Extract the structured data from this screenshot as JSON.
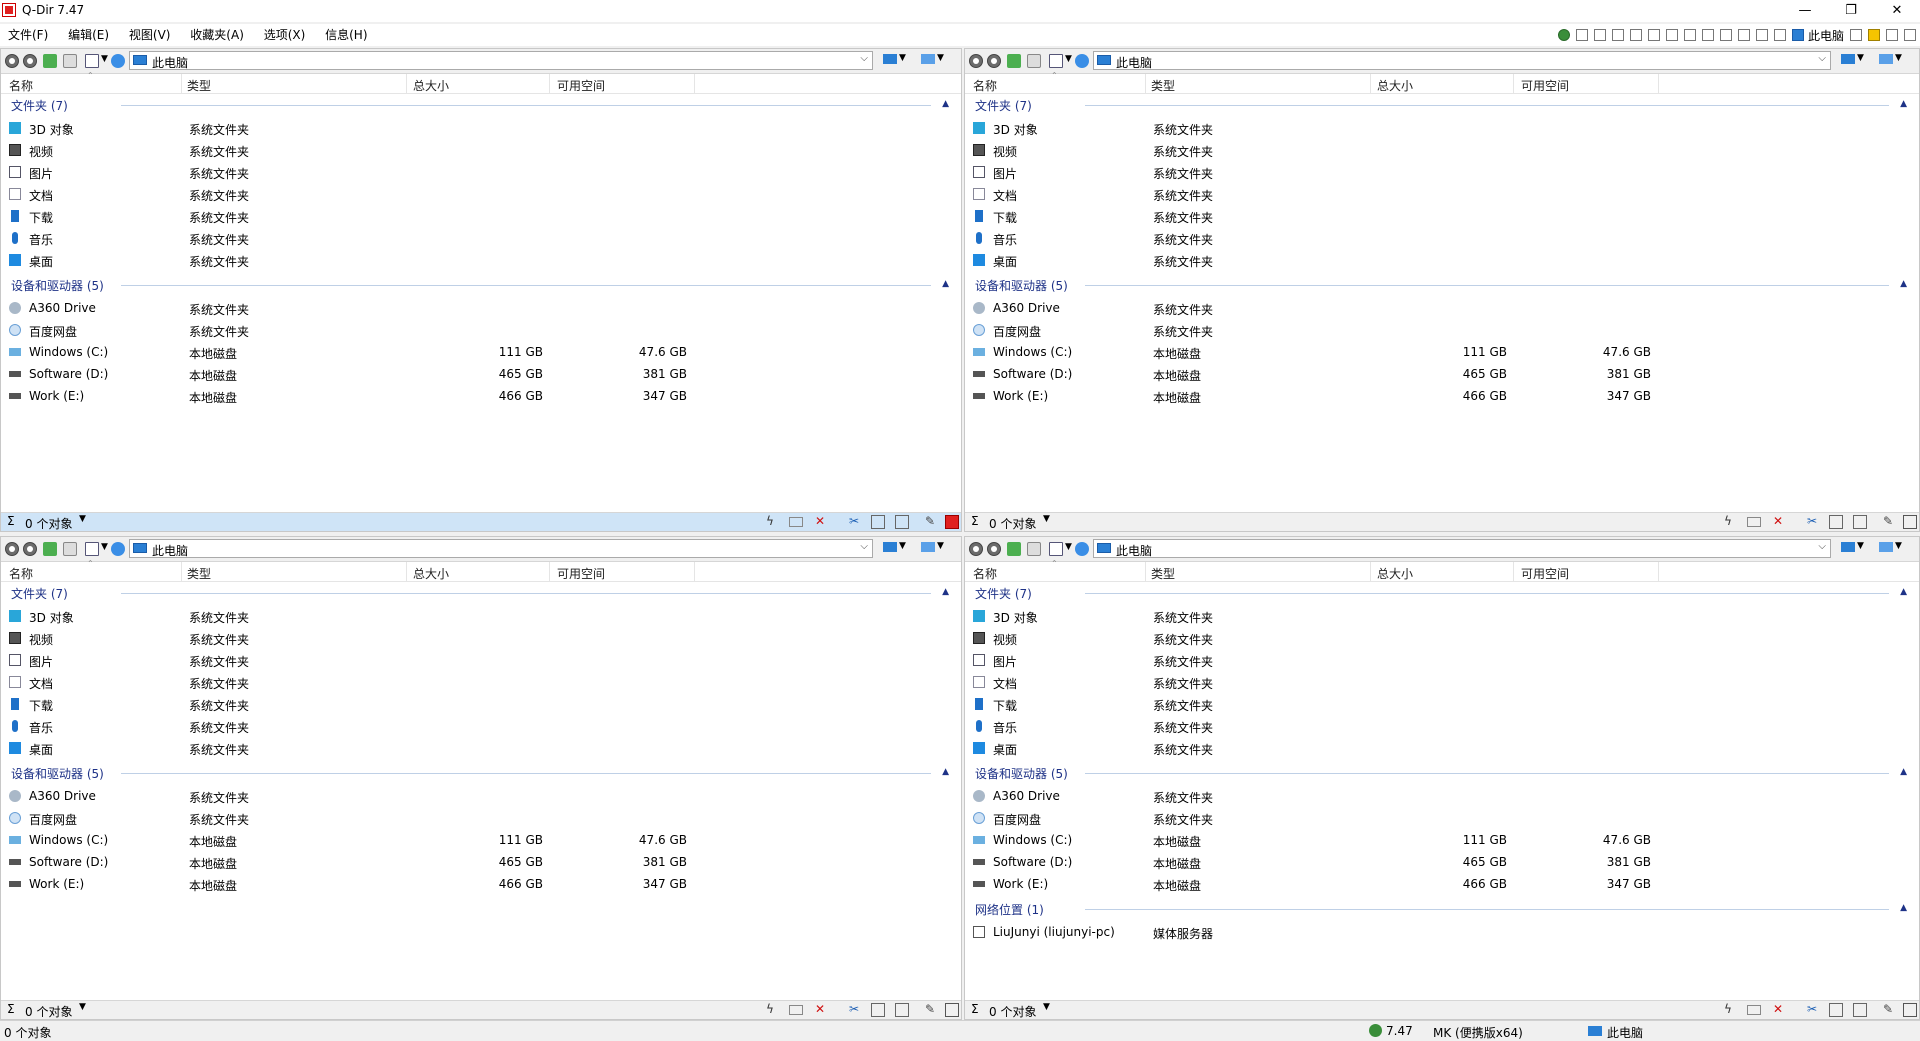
{
  "window": {
    "title": "Q-Dir 7.47",
    "controls": {
      "minimize": "—",
      "maximize": "❐",
      "close": "✕"
    }
  },
  "menu": {
    "items": [
      "文件(F)",
      "编辑(E)",
      "视图(V)",
      "收藏夹(A)",
      "选项(X)",
      "信息(H)"
    ],
    "right_location": "此电脑"
  },
  "columns": {
    "name": "名称",
    "type": "类型",
    "total": "总大小",
    "free": "可用空间"
  },
  "panes": [
    {
      "address": "此电脑",
      "groups": [
        {
          "title": "文件夹 (7)",
          "rows": [
            {
              "icon": "3d",
              "name": "3D 对象",
              "type": "系统文件夹",
              "size": "",
              "free": ""
            },
            {
              "icon": "video",
              "name": "视频",
              "type": "系统文件夹",
              "size": "",
              "free": ""
            },
            {
              "icon": "pic",
              "name": "图片",
              "type": "系统文件夹",
              "size": "",
              "free": ""
            },
            {
              "icon": "doc",
              "name": "文档",
              "type": "系统文件夹",
              "size": "",
              "free": ""
            },
            {
              "icon": "down",
              "name": "下载",
              "type": "系统文件夹",
              "size": "",
              "free": ""
            },
            {
              "icon": "music",
              "name": "音乐",
              "type": "系统文件夹",
              "size": "",
              "free": ""
            },
            {
              "icon": "desk",
              "name": "桌面",
              "type": "系统文件夹",
              "size": "",
              "free": ""
            }
          ]
        },
        {
          "title": "设备和驱动器 (5)",
          "rows": [
            {
              "icon": "a360",
              "name": "A360 Drive",
              "type": "系统文件夹",
              "size": "",
              "free": ""
            },
            {
              "icon": "baidu",
              "name": "百度网盘",
              "type": "系统文件夹",
              "size": "",
              "free": ""
            },
            {
              "icon": "diskc",
              "name": "Windows (C:)",
              "type": "本地磁盘",
              "size": "111 GB",
              "free": "47.6 GB"
            },
            {
              "icon": "disk",
              "name": "Software (D:)",
              "type": "本地磁盘",
              "size": "465 GB",
              "free": "381 GB"
            },
            {
              "icon": "disk",
              "name": "Work (E:)",
              "type": "本地磁盘",
              "size": "466 GB",
              "free": "347 GB"
            }
          ]
        }
      ],
      "status": "0 个对象",
      "active": true
    },
    {
      "address": "此电脑",
      "groups": [
        {
          "title": "文件夹 (7)",
          "rows": [
            {
              "icon": "3d",
              "name": "3D 对象",
              "type": "系统文件夹",
              "size": "",
              "free": ""
            },
            {
              "icon": "video",
              "name": "视频",
              "type": "系统文件夹",
              "size": "",
              "free": ""
            },
            {
              "icon": "pic",
              "name": "图片",
              "type": "系统文件夹",
              "size": "",
              "free": ""
            },
            {
              "icon": "doc",
              "name": "文档",
              "type": "系统文件夹",
              "size": "",
              "free": ""
            },
            {
              "icon": "down",
              "name": "下载",
              "type": "系统文件夹",
              "size": "",
              "free": ""
            },
            {
              "icon": "music",
              "name": "音乐",
              "type": "系统文件夹",
              "size": "",
              "free": ""
            },
            {
              "icon": "desk",
              "name": "桌面",
              "type": "系统文件夹",
              "size": "",
              "free": ""
            }
          ]
        },
        {
          "title": "设备和驱动器 (5)",
          "rows": [
            {
              "icon": "a360",
              "name": "A360 Drive",
              "type": "系统文件夹",
              "size": "",
              "free": ""
            },
            {
              "icon": "baidu",
              "name": "百度网盘",
              "type": "系统文件夹",
              "size": "",
              "free": ""
            },
            {
              "icon": "diskc",
              "name": "Windows (C:)",
              "type": "本地磁盘",
              "size": "111 GB",
              "free": "47.6 GB"
            },
            {
              "icon": "disk",
              "name": "Software (D:)",
              "type": "本地磁盘",
              "size": "465 GB",
              "free": "381 GB"
            },
            {
              "icon": "disk",
              "name": "Work (E:)",
              "type": "本地磁盘",
              "size": "466 GB",
              "free": "347 GB"
            }
          ]
        }
      ],
      "status": "0 个对象",
      "active": false
    },
    {
      "address": "此电脑",
      "groups": [
        {
          "title": "文件夹 (7)",
          "rows": [
            {
              "icon": "3d",
              "name": "3D 对象",
              "type": "系统文件夹",
              "size": "",
              "free": ""
            },
            {
              "icon": "video",
              "name": "视频",
              "type": "系统文件夹",
              "size": "",
              "free": ""
            },
            {
              "icon": "pic",
              "name": "图片",
              "type": "系统文件夹",
              "size": "",
              "free": ""
            },
            {
              "icon": "doc",
              "name": "文档",
              "type": "系统文件夹",
              "size": "",
              "free": ""
            },
            {
              "icon": "down",
              "name": "下载",
              "type": "系统文件夹",
              "size": "",
              "free": ""
            },
            {
              "icon": "music",
              "name": "音乐",
              "type": "系统文件夹",
              "size": "",
              "free": ""
            },
            {
              "icon": "desk",
              "name": "桌面",
              "type": "系统文件夹",
              "size": "",
              "free": ""
            }
          ]
        },
        {
          "title": "设备和驱动器 (5)",
          "rows": [
            {
              "icon": "a360",
              "name": "A360 Drive",
              "type": "系统文件夹",
              "size": "",
              "free": ""
            },
            {
              "icon": "baidu",
              "name": "百度网盘",
              "type": "系统文件夹",
              "size": "",
              "free": ""
            },
            {
              "icon": "diskc",
              "name": "Windows (C:)",
              "type": "本地磁盘",
              "size": "111 GB",
              "free": "47.6 GB"
            },
            {
              "icon": "disk",
              "name": "Software (D:)",
              "type": "本地磁盘",
              "size": "465 GB",
              "free": "381 GB"
            },
            {
              "icon": "disk",
              "name": "Work (E:)",
              "type": "本地磁盘",
              "size": "466 GB",
              "free": "347 GB"
            }
          ]
        }
      ],
      "status": "0 个对象",
      "active": false
    },
    {
      "address": "此电脑",
      "groups": [
        {
          "title": "文件夹 (7)",
          "rows": [
            {
              "icon": "3d",
              "name": "3D 对象",
              "type": "系统文件夹",
              "size": "",
              "free": ""
            },
            {
              "icon": "video",
              "name": "视频",
              "type": "系统文件夹",
              "size": "",
              "free": ""
            },
            {
              "icon": "pic",
              "name": "图片",
              "type": "系统文件夹",
              "size": "",
              "free": ""
            },
            {
              "icon": "doc",
              "name": "文档",
              "type": "系统文件夹",
              "size": "",
              "free": ""
            },
            {
              "icon": "down",
              "name": "下载",
              "type": "系统文件夹",
              "size": "",
              "free": ""
            },
            {
              "icon": "music",
              "name": "音乐",
              "type": "系统文件夹",
              "size": "",
              "free": ""
            },
            {
              "icon": "desk",
              "name": "桌面",
              "type": "系统文件夹",
              "size": "",
              "free": ""
            }
          ]
        },
        {
          "title": "设备和驱动器 (5)",
          "rows": [
            {
              "icon": "a360",
              "name": "A360 Drive",
              "type": "系统文件夹",
              "size": "",
              "free": ""
            },
            {
              "icon": "baidu",
              "name": "百度网盘",
              "type": "系统文件夹",
              "size": "",
              "free": ""
            },
            {
              "icon": "diskc",
              "name": "Windows (C:)",
              "type": "本地磁盘",
              "size": "111 GB",
              "free": "47.6 GB"
            },
            {
              "icon": "disk",
              "name": "Software (D:)",
              "type": "本地磁盘",
              "size": "465 GB",
              "free": "381 GB"
            },
            {
              "icon": "disk",
              "name": "Work (E:)",
              "type": "本地磁盘",
              "size": "466 GB",
              "free": "347 GB"
            }
          ]
        },
        {
          "title": "网络位置 (1)",
          "rows": [
            {
              "icon": "media",
              "name": "LiuJunyi (liujunyi-pc)",
              "type": "媒体服务器",
              "size": "",
              "free": ""
            }
          ]
        }
      ],
      "status": "0 个对象",
      "active": false
    }
  ],
  "statusbar": {
    "left": "0 个对象",
    "version": "7.47",
    "edition": "MK (便携版x64)",
    "location": "此电脑"
  }
}
